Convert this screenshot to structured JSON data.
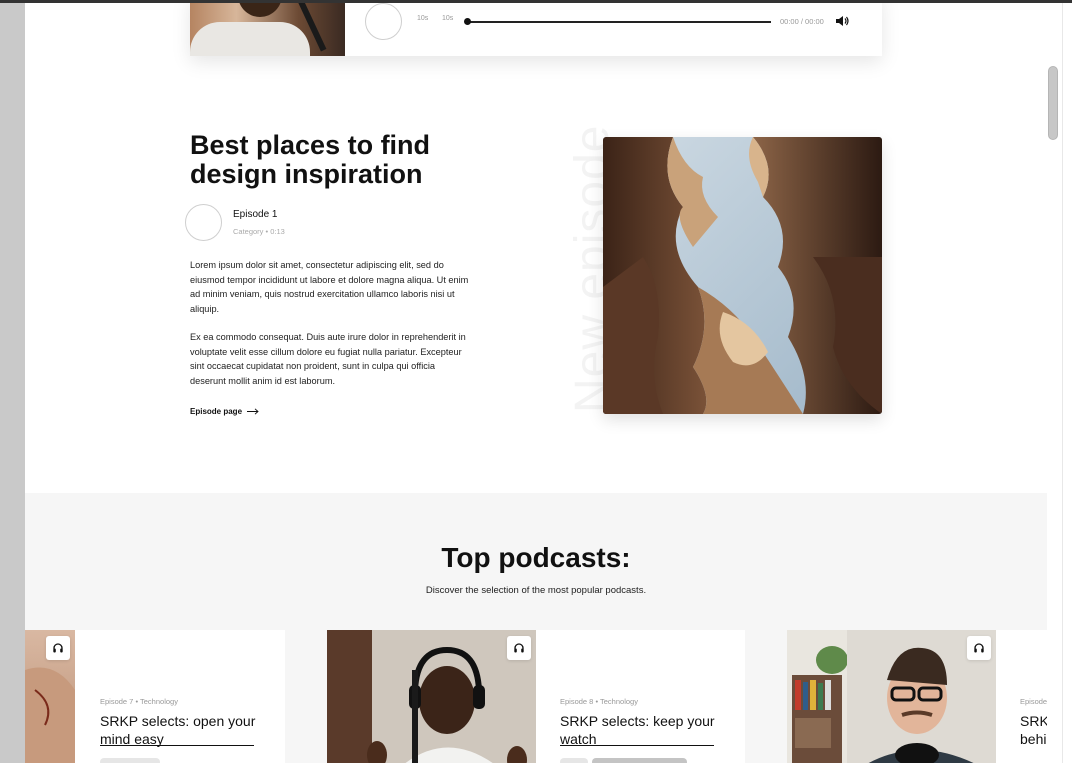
{
  "player": {
    "skip_back": "10s",
    "skip_forward": "10s",
    "time": "00:00 / 00:00",
    "progress": 0
  },
  "episode": {
    "title": "Best places to find design inspiration",
    "name": "Episode 1",
    "meta": "Category • 0:13",
    "paragraph_1": "Lorem ipsum dolor sit amet, consectetur adipiscing elit, sed do eiusmod tempor incididunt ut labore et dolore magna aliqua. Ut enim ad minim veniam, quis nostrud exercitation ullamco laboris nisi ut aliquip.",
    "paragraph_2": "Ex ea commodo consequat. Duis aute irure dolor in reprehenderit in voluptate velit esse cillum dolore eu fugiat nulla pariatur. Excepteur sint occaecat cupidatat non proident, sunt in culpa qui officia deserunt mollit anim id est laborum.",
    "link_label": "Episode page",
    "vertical_label": "New episode"
  },
  "top_podcasts": {
    "title": "Top podcasts:",
    "subtitle": "Discover the selection of the most popular podcasts.",
    "cards": [
      {
        "meta": "Episode 7 • Technology",
        "title": "SRKP selects: open your mind easy"
      },
      {
        "meta": "Episode 8 • Technology",
        "title": "SRKP selects: keep your watch"
      },
      {
        "meta": "Episode",
        "title": "SRK behi"
      }
    ]
  },
  "colors": {
    "page_background": "#ffffff",
    "section_background": "#f6f6f6",
    "text": "#111111",
    "muted_text": "#999999"
  },
  "icons": {
    "badge": "headphones-icon",
    "volume": "volume-icon",
    "link": "arrow-right-icon"
  }
}
